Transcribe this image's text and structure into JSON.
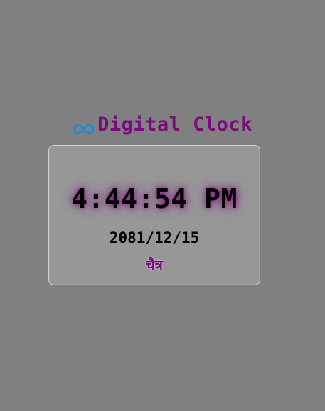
{
  "app": {
    "title": "Digital Clock",
    "title_icon": "infinity-icon",
    "accent_color": "#7b0a7f",
    "icon_color": "#1b8fd1",
    "background_color": "#808080"
  },
  "clock": {
    "time": "4:44:54 PM",
    "date": "2081/12/15",
    "month": "चैत्र"
  }
}
